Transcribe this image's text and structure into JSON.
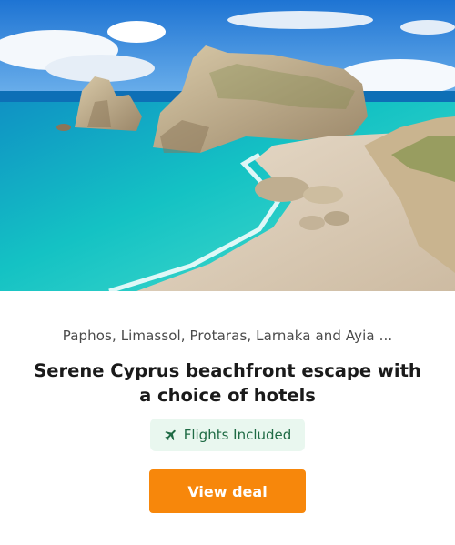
{
  "card": {
    "location": "Paphos, Limassol, Protaras, Larnaka and Ayia ...",
    "title": "Serene Cyprus beachfront escape with a choice of hotels",
    "badge": {
      "icon": "plane-icon",
      "label": "Flights Included"
    },
    "cta_label": "View deal"
  },
  "colors": {
    "cta_background": "#f7870b",
    "badge_background": "#e9f7ef",
    "badge_text": "#1f6b45"
  }
}
